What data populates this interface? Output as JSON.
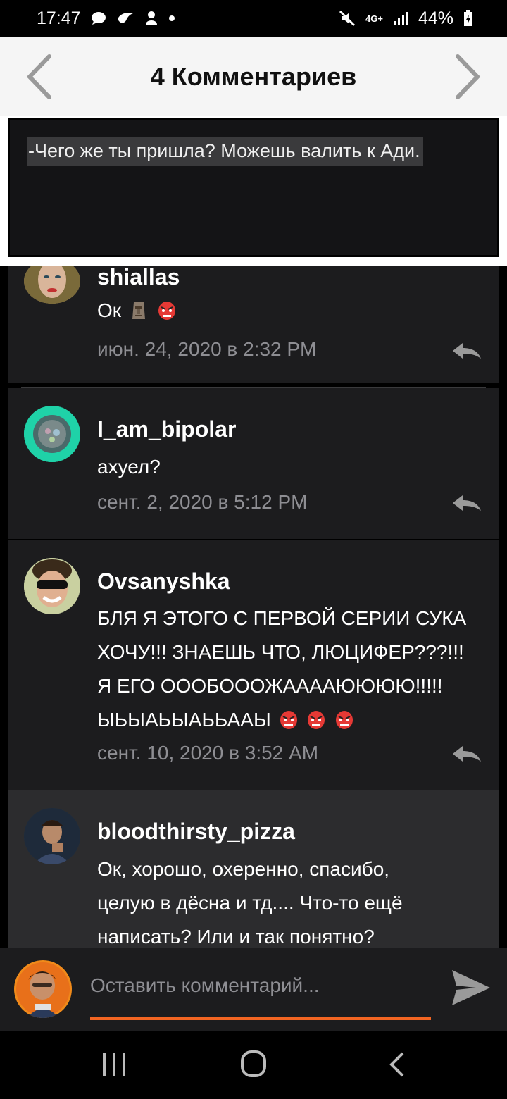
{
  "status_bar": {
    "time": "17:47",
    "left_icons": [
      "chat-bubble-icon",
      "bird-icon",
      "notification-icon",
      "dot-icon"
    ],
    "network": "4G+",
    "battery": "44%"
  },
  "header": {
    "title": "4 Комментариев"
  },
  "quote": {
    "text": "-Чего же ты пришла? Можешь валить к Ади."
  },
  "comments": [
    {
      "author": "shiallas",
      "text": "Ок",
      "emojis": [
        "moai-icon",
        "red-mask-icon"
      ],
      "date": "июн. 24, 2020 в 2:32 PM"
    },
    {
      "author": "I_am_bipolar",
      "text": "ахуел?",
      "date": "сент. 2, 2020 в 5:12 PM"
    },
    {
      "author": "Ovsanyshka",
      "text_lines": [
        "БЛЯ Я ЭТОГО С ПЕРВОЙ СЕРИИ СУКА",
        "ХОЧУ!!! ЗНАЕШЬ ЧТО, ЛЮЦИФЕР???!!!",
        "Я ЕГО ОООБОООЖААААЮЮЮЮ!!!!!",
        "ЫЬЫАЬЫАЬЬААЫ"
      ],
      "emojis": [
        "red-mask-icon",
        "red-mask-icon",
        "red-mask-icon"
      ],
      "date": "сент. 10, 2020 в 3:52 AM"
    },
    {
      "author": "bloodthirsty_pizza",
      "text_lines": [
        "Ок, хорошо, охеренно, спасибо,",
        "целую в дёсна и тд.... Что-то ещё",
        "написать? Или и так понятно?"
      ]
    }
  ],
  "composer": {
    "placeholder": "Оставить комментарий..."
  },
  "colors": {
    "accent": "#f26522",
    "card": "#1c1c1e",
    "card_highlight": "#2c2c2e",
    "muted_text": "#8e8e93"
  }
}
